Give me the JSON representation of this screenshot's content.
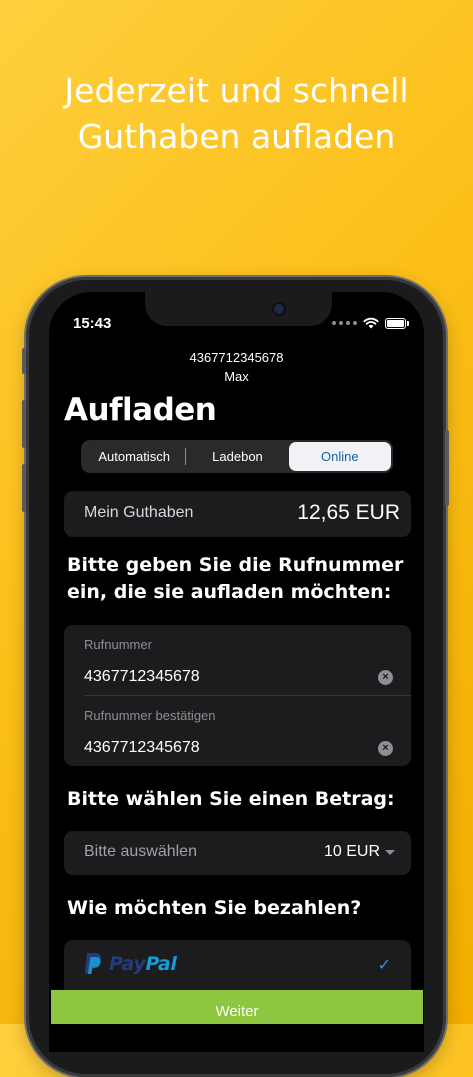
{
  "headline": {
    "line1": "Jederzeit und schnell",
    "line2": "Guthaben aufladen"
  },
  "status_bar": {
    "time": "15:43",
    "icons": [
      "signal-dots-icon",
      "wifi-icon",
      "battery-icon"
    ]
  },
  "nav": {
    "number": "4367712345678",
    "name": "Max"
  },
  "page_title": "Aufladen",
  "tabs": [
    {
      "label": "Automatisch",
      "selected": false
    },
    {
      "label": "Ladebon",
      "selected": false
    },
    {
      "label": "Online",
      "selected": true
    }
  ],
  "balance": {
    "label": "Mein Guthaben",
    "value": "12,65 EUR"
  },
  "phone_section": {
    "heading_line1": "Bitte geben Sie die Rufnummer",
    "heading_line2": "ein, die sie aufladen möchten:",
    "fields": [
      {
        "label": "Rufnummer",
        "value": "4367712345678"
      },
      {
        "label": "Rufnummer bestätigen",
        "value": "4367712345678"
      }
    ]
  },
  "amount_section": {
    "heading": "Bitte wählen Sie einen Betrag:",
    "placeholder": "Bitte auswählen",
    "selected_value": "10 EUR"
  },
  "payment_section": {
    "heading": "Wie möchten Sie bezahlen?",
    "options": [
      {
        "brand_part1": "Pay",
        "brand_part2": "Pal",
        "selected": true,
        "check": "✓"
      }
    ]
  },
  "cta": {
    "label": "Weiter"
  },
  "colors": {
    "background": "#fbbf18",
    "accent_blue": "#1a5fa8",
    "cta_green": "#8dc63f",
    "card": "#1c1c1e",
    "paypal_dark": "#253b80",
    "paypal_light": "#179bd7"
  }
}
